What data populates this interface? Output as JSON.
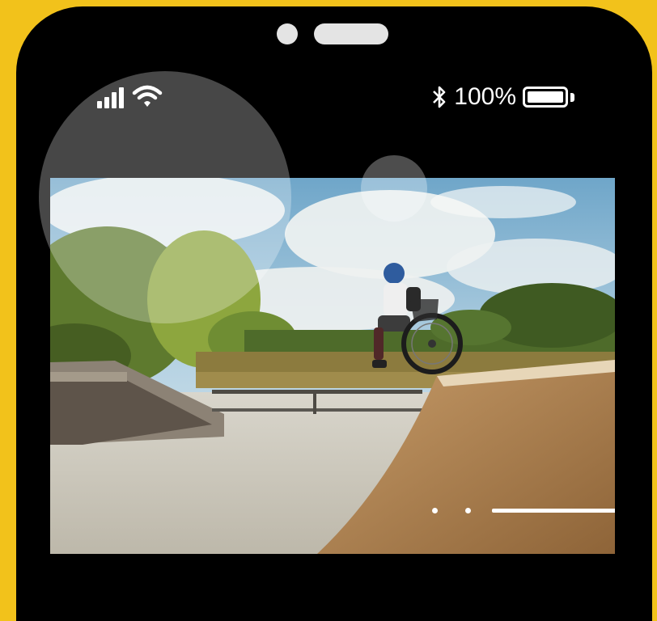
{
  "status_bar": {
    "battery_text": "100%",
    "battery_level": 1.0,
    "signal_bars": 4,
    "icons": [
      "signal-icon",
      "wifi-icon",
      "bluetooth-icon",
      "battery-icon"
    ]
  },
  "photo": {
    "subject": "wheelchair-skater-photo"
  },
  "carousel": {
    "slide_count": 3,
    "active_index": 2
  },
  "colors": {
    "background": "#F2C21B",
    "phone_body": "#000000",
    "accent": "#FFFFFF"
  }
}
